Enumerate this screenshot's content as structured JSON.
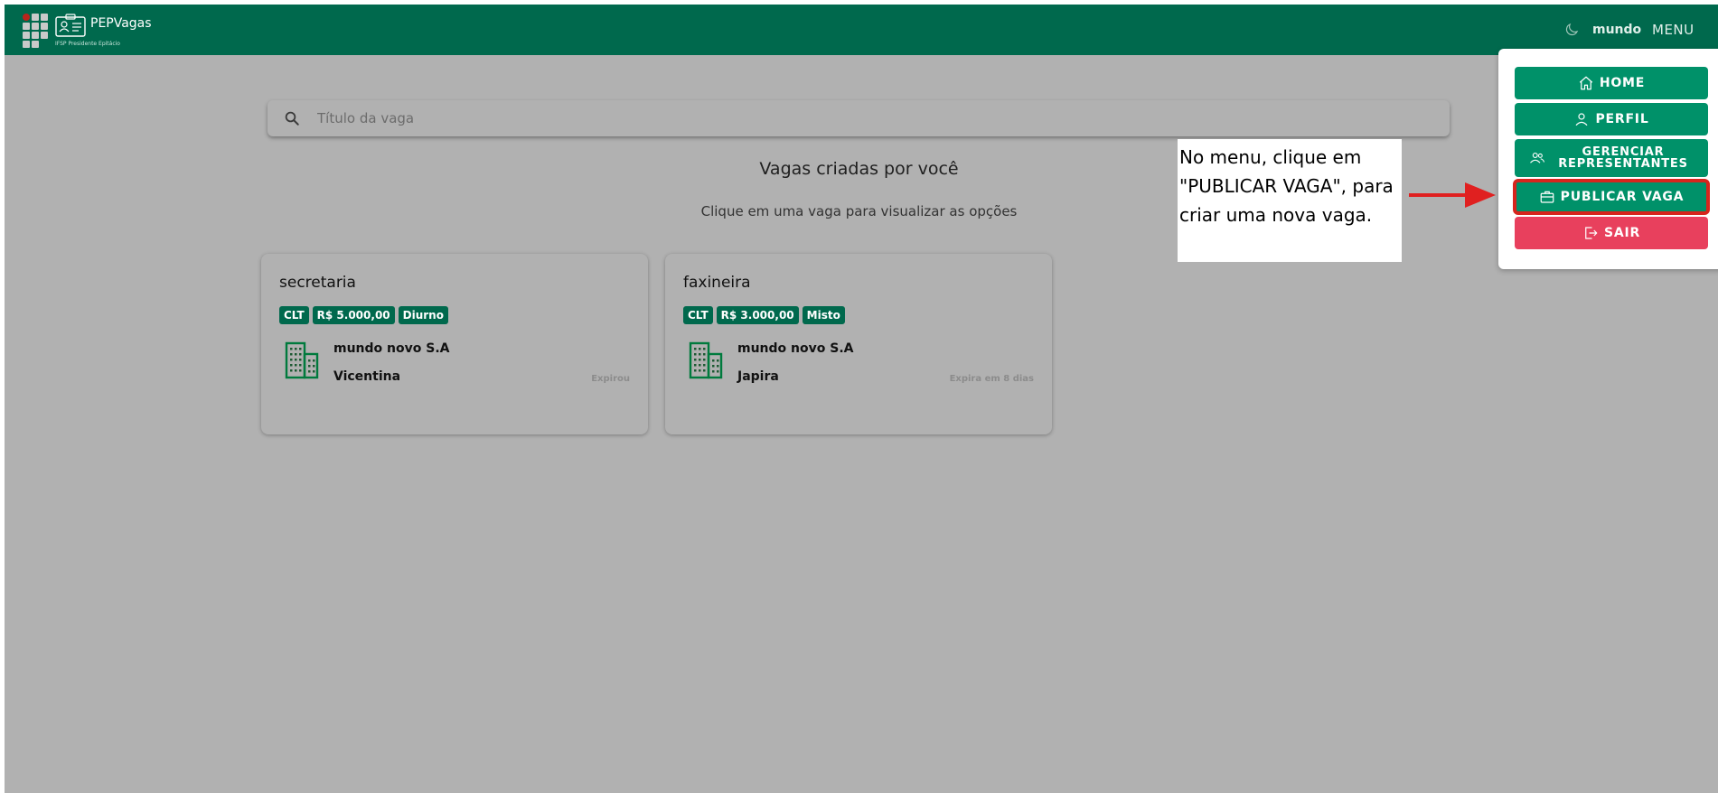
{
  "header": {
    "app_title": "PEPVagas",
    "app_subtitle": "IFSP Presidente Epitácio",
    "user_name": "mundo",
    "menu_label": "MENU",
    "brand_color": "#00694d"
  },
  "search": {
    "placeholder": "Título da vaga"
  },
  "main": {
    "title": "Vagas criadas por você",
    "subtitle": "Clique em uma vaga para visualizar as opções",
    "jobs": [
      {
        "title": "secretaria",
        "contract": "CLT",
        "salary": "R$ 5.000,00",
        "shift": "Diurno",
        "company": "mundo novo S.A",
        "city": "Vicentina",
        "expiry": "Expirou"
      },
      {
        "title": "faxineira",
        "contract": "CLT",
        "salary": "R$ 3.000,00",
        "shift": "Misto",
        "company": "mundo novo S.A",
        "city": "Japira",
        "expiry": "Expira em 8 dias"
      }
    ]
  },
  "menu": {
    "items": [
      {
        "label": "HOME",
        "icon": "home-icon"
      },
      {
        "label": "PERFIL",
        "icon": "user-icon"
      },
      {
        "label": "GERENCIAR REPRESENTANTES",
        "icon": "users-icon"
      },
      {
        "label": "PUBLICAR VAGA",
        "icon": "briefcase-icon"
      },
      {
        "label": "SAIR",
        "icon": "logout-icon"
      }
    ],
    "button_color": "#009169",
    "logout_color": "#e8405d",
    "highlight_color": "#d6251d"
  },
  "annotation": {
    "text": "No menu, clique em \"PUBLICAR VAGA\", para criar uma nova vaga."
  }
}
